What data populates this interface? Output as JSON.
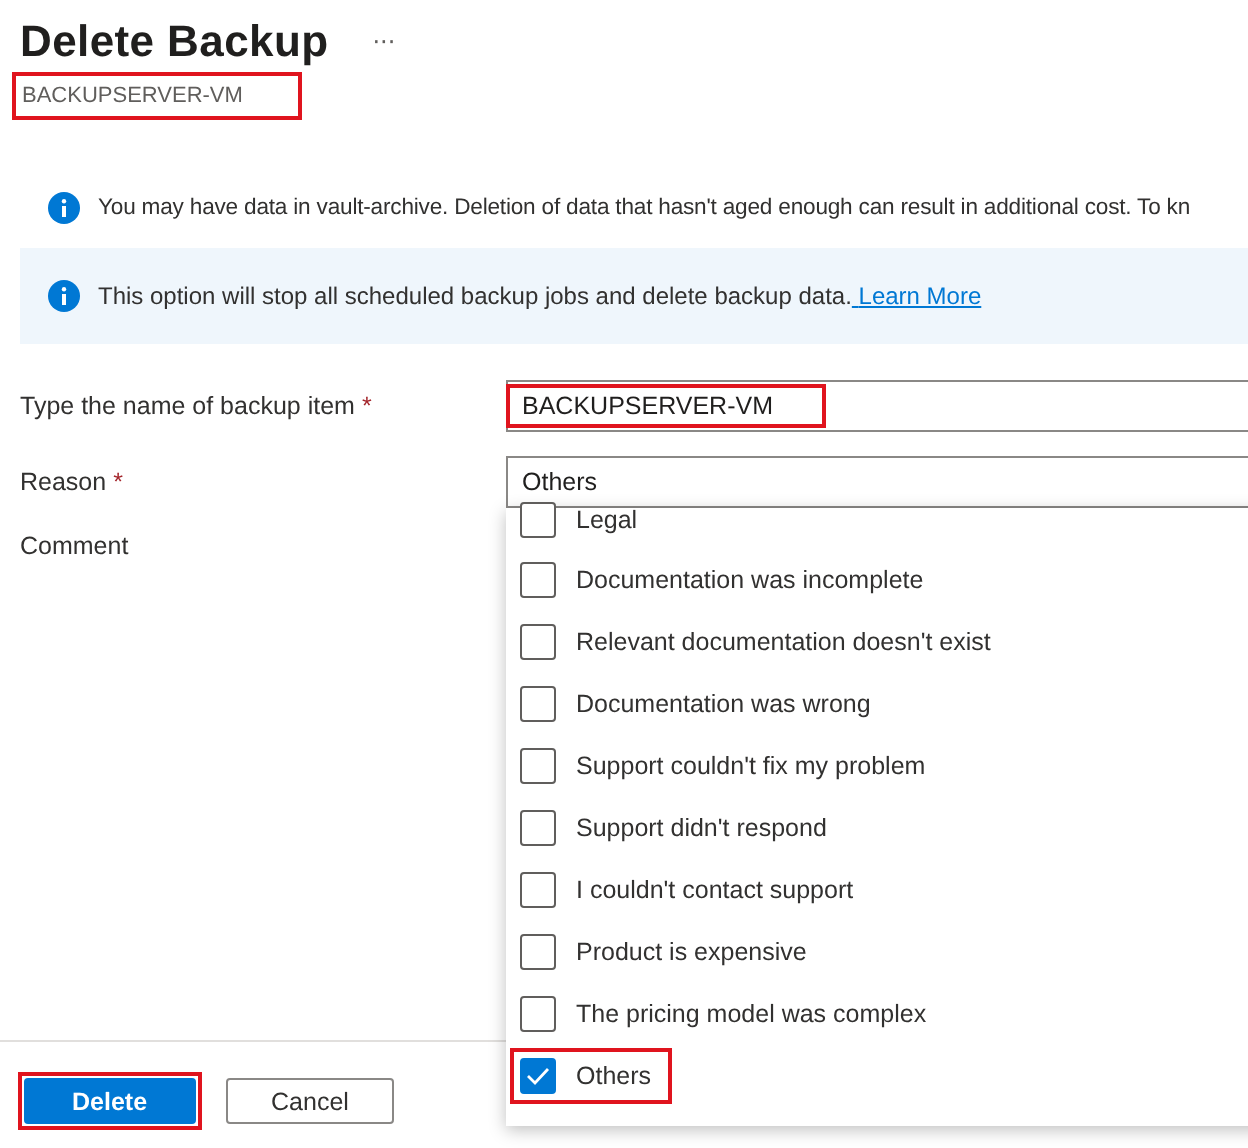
{
  "header": {
    "title": "Delete Backup",
    "more": "···",
    "subtitle": "BACKUPSERVER-VM",
    "subtitle_highlighted": true
  },
  "notices": [
    {
      "kind": "plain",
      "text": "You may have data in vault-archive. Deletion of data that hasn't aged enough can result in additional cost. To kn"
    },
    {
      "kind": "banner",
      "text": "This option will stop all scheduled backup jobs and delete backup data.",
      "link": "Learn More"
    }
  ],
  "form": {
    "name_field": {
      "label": "Type the name of backup item",
      "required_mark": "*",
      "value": "BACKUPSERVER-VM",
      "highlighted": true
    },
    "reason": {
      "label": "Reason",
      "required_mark": "*",
      "value": "Others",
      "expanded": true,
      "options": [
        {
          "label": "Legal",
          "checked": false,
          "highlighted": false
        },
        {
          "label": "Documentation was incomplete",
          "checked": false,
          "highlighted": false
        },
        {
          "label": "Relevant documentation doesn't exist",
          "checked": false,
          "highlighted": false
        },
        {
          "label": "Documentation was wrong",
          "checked": false,
          "highlighted": false
        },
        {
          "label": "Support couldn't fix my problem",
          "checked": false,
          "highlighted": false
        },
        {
          "label": "Support didn't respond",
          "checked": false,
          "highlighted": false
        },
        {
          "label": "I couldn't contact support",
          "checked": false,
          "highlighted": false
        },
        {
          "label": "Product is expensive",
          "checked": false,
          "highlighted": false
        },
        {
          "label": "The pricing model was complex",
          "checked": false,
          "highlighted": false
        },
        {
          "label": "Others",
          "checked": true,
          "highlighted": true
        }
      ]
    },
    "comment": {
      "label": "Comment"
    }
  },
  "buttons": [
    {
      "kind": "primary",
      "label": "Delete",
      "highlighted": true
    },
    {
      "kind": "secondary",
      "label": "Cancel",
      "highlighted": false
    }
  ]
}
